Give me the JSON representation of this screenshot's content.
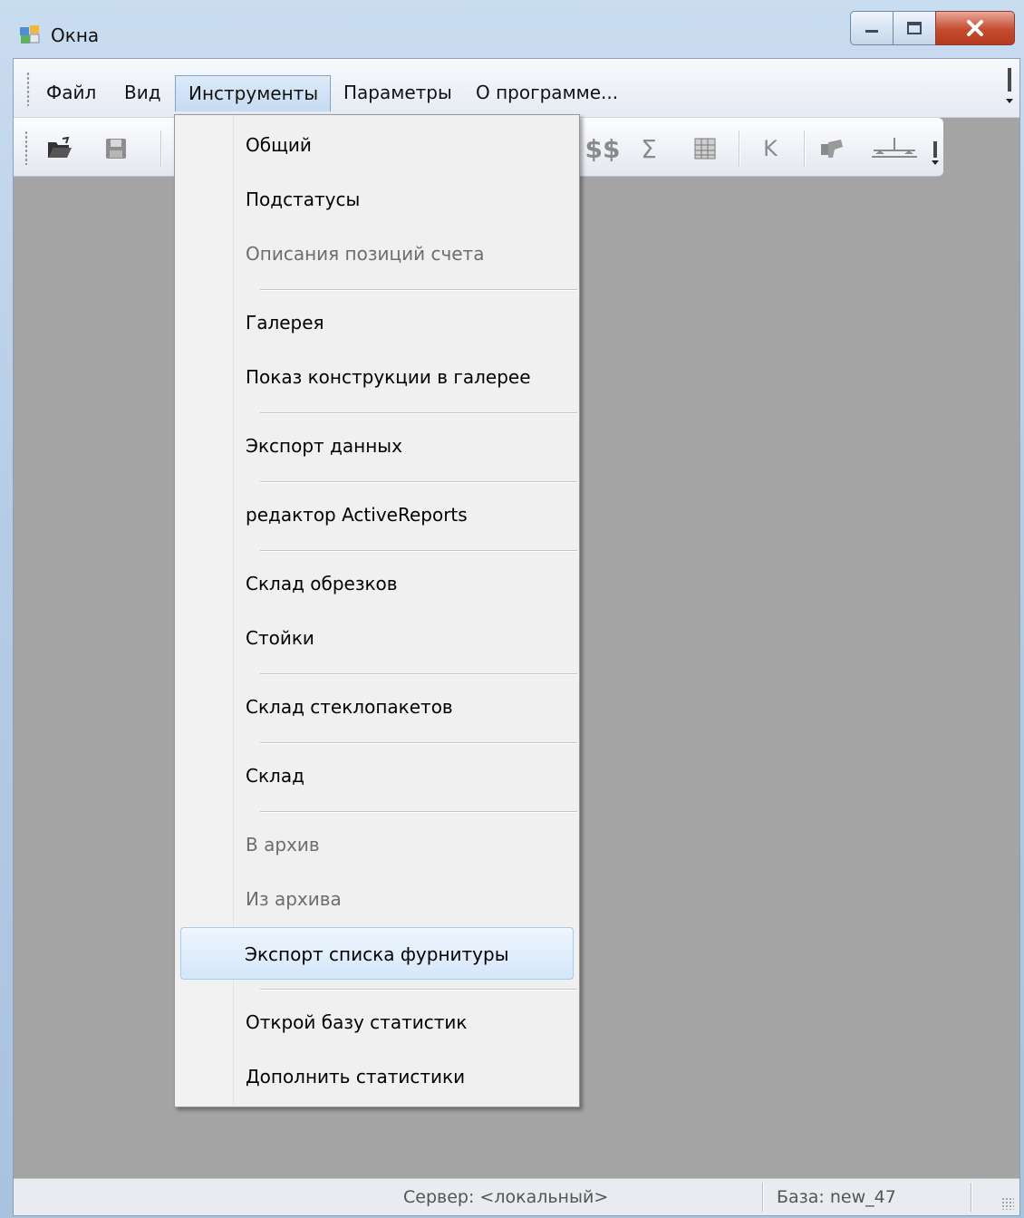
{
  "window": {
    "title": "Окна"
  },
  "menubar": {
    "items": [
      {
        "label": "Файл"
      },
      {
        "label": "Вид"
      },
      {
        "label": "Инструменты"
      },
      {
        "label": "Параметры"
      },
      {
        "label": "О программе..."
      }
    ],
    "active_item": "Инструменты"
  },
  "toolbar": {
    "icons": [
      "open-folder-icon",
      "save-icon",
      "currency-icon",
      "sum-icon",
      "table-icon",
      "k-icon",
      "tool-icon",
      "scale-icon"
    ],
    "labels": {
      "currency": "$$",
      "sum": "Σ",
      "k": "K"
    }
  },
  "dropdown": {
    "items": [
      {
        "label": "Общий",
        "disabled": false
      },
      {
        "label": "Подстатусы",
        "disabled": false
      },
      {
        "label": "Описания позиций счета",
        "disabled": true
      },
      {
        "label": "Галерея",
        "disabled": false
      },
      {
        "label": "Показ конструкции в галерее",
        "disabled": false
      },
      {
        "label": "Экспорт данных",
        "disabled": false
      },
      {
        "label": "редактор ActiveReports",
        "disabled": false
      },
      {
        "label": "Склад обрезков",
        "disabled": false
      },
      {
        "label": "Стойки",
        "disabled": false
      },
      {
        "label": "Склад стеклопакетов",
        "disabled": false
      },
      {
        "label": "Склад",
        "disabled": false
      },
      {
        "label": "В архив",
        "disabled": true
      },
      {
        "label": "Из архива",
        "disabled": true
      },
      {
        "label": "Экспорт списка фурнитуры",
        "disabled": false,
        "highlighted": true
      },
      {
        "label": "Открой базу статистик",
        "disabled": false
      },
      {
        "label": "Дополнить статистики",
        "disabled": false
      }
    ]
  },
  "statusbar": {
    "server": "Сервер: <локальный>",
    "database": "База: new_47"
  },
  "colors": {
    "menu_highlight": "#d5e7fb",
    "close_button": "#c44b2e",
    "client_bg": "#a4a4a4"
  }
}
